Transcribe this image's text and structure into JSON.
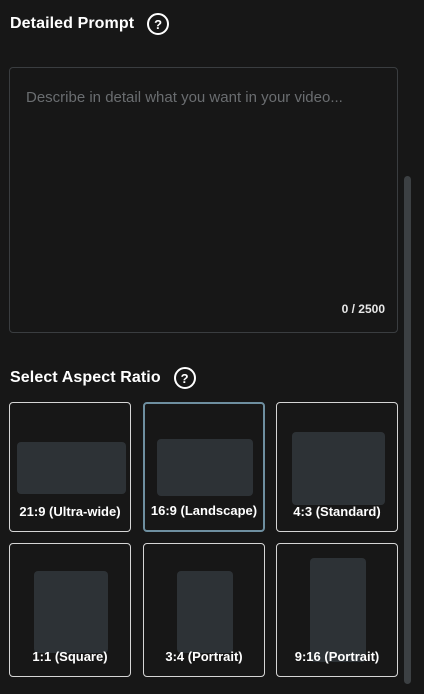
{
  "prompt_section": {
    "title": "Detailed Prompt",
    "help_glyph": "?",
    "placeholder": "Describe in detail what you want in your video...",
    "value": "",
    "char_count": "0 / 2500"
  },
  "aspect_section": {
    "title": "Select Aspect Ratio",
    "help_glyph": "?",
    "options": [
      {
        "label": "21:9 (Ultra-wide)",
        "selected": false
      },
      {
        "label": "16:9 (Landscape)",
        "selected": true
      },
      {
        "label": "4:3 (Standard)",
        "selected": false
      },
      {
        "label": "1:1 (Square)",
        "selected": false
      },
      {
        "label": "3:4 (Portrait)",
        "selected": false
      },
      {
        "label": "9:16 (Portrait)",
        "selected": false
      }
    ]
  },
  "colors": {
    "background": "#171717",
    "shape_fill": "#2d3236",
    "selected_border": "#6e8fa0",
    "card_border": "#d6d6d6"
  },
  "icons": {
    "help": "help-circle-icon"
  }
}
